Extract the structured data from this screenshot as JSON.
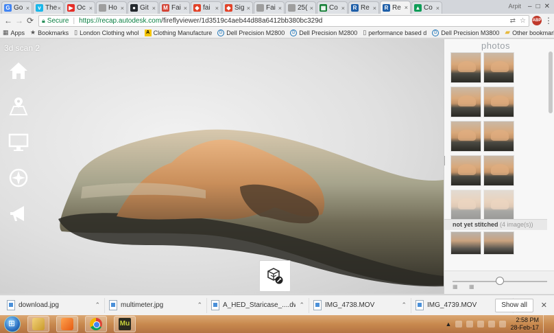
{
  "browser": {
    "tabs": [
      {
        "label": "Go",
        "favicon": "google-icon",
        "color": "#4285f4",
        "glyph": "G"
      },
      {
        "label": "The",
        "favicon": "vimeo-icon",
        "color": "#1ab7ea",
        "glyph": "v"
      },
      {
        "label": "Oc",
        "favicon": "youtube-icon",
        "color": "#e52d27",
        "glyph": "▶"
      },
      {
        "label": "Ho",
        "favicon": "page-icon",
        "color": "#9e9e9e",
        "glyph": ""
      },
      {
        "label": "Git",
        "favicon": "github-icon",
        "color": "#24292e",
        "glyph": "●"
      },
      {
        "label": "Fai",
        "favicon": "gmail-icon",
        "color": "#d44638",
        "glyph": "M"
      },
      {
        "label": "fai",
        "favicon": "gitlab-icon",
        "color": "#e24329",
        "glyph": "◆"
      },
      {
        "label": "Sig",
        "favicon": "gitlab-icon",
        "color": "#e24329",
        "glyph": "◆"
      },
      {
        "label": "Fai",
        "favicon": "page-icon",
        "color": "#9e9e9e",
        "glyph": ""
      },
      {
        "label": "25(",
        "favicon": "page-icon",
        "color": "#9e9e9e",
        "glyph": ""
      },
      {
        "label": "Co",
        "favicon": "sheets-icon",
        "color": "#188038",
        "glyph": "▦"
      },
      {
        "label": "Re",
        "favicon": "recap-icon",
        "color": "#1f5fa8",
        "glyph": "R"
      },
      {
        "label": "Re",
        "favicon": "recap-icon",
        "color": "#1f5fa8",
        "glyph": "R",
        "active": true
      },
      {
        "label": "Co",
        "favicon": "drive-icon",
        "color": "#0f9d58",
        "glyph": "▲"
      }
    ],
    "user_label": "Arpit",
    "address": {
      "secure_label": "Secure",
      "url_host": "https://recap.autodesk.com",
      "url_path": "/fireflyviewer/1d3519c4aeb44d88a6412bb380bc329d"
    },
    "abp_label": "ABP",
    "bookmarks": [
      {
        "label": "Apps",
        "icon": "apps-grid-icon",
        "glyph": "▦"
      },
      {
        "label": "Bookmarks",
        "icon": "star-icon",
        "glyph": "★"
      },
      {
        "label": "London Clothing whol",
        "icon": "page-icon",
        "glyph": "▯"
      },
      {
        "label": "Clothing Manufacture",
        "icon": "cm-icon",
        "glyph": "A"
      },
      {
        "label": "Dell Precision M2800",
        "icon": "dell-icon",
        "glyph": "D"
      },
      {
        "label": "Dell Precision M2800",
        "icon": "dell-icon",
        "glyph": "D"
      },
      {
        "label": "performance based d",
        "icon": "page-icon",
        "glyph": "▯"
      },
      {
        "label": "Dell Precision M3800",
        "icon": "dell-icon",
        "glyph": "D"
      }
    ],
    "other_bookmarks": "Other bookmarks"
  },
  "viewer": {
    "title": "3d scan 2",
    "tools": [
      "home-icon",
      "map-pin-icon",
      "monitor-icon",
      "compass-icon",
      "megaphone-icon"
    ]
  },
  "photos_panel": {
    "title": "photos",
    "thumb_count": 10,
    "not_yet_stitched_label": "not yet stitched",
    "not_yet_stitched_count": "(4 image(s))",
    "zoom_level": 0.5
  },
  "downloads": [
    {
      "name": "download.jpg"
    },
    {
      "name": "multimeter.jpg"
    },
    {
      "name": "A_HED_Staricase_....dwg"
    },
    {
      "name": "IMG_4738.MOV"
    },
    {
      "name": "IMG_4739.MOV"
    }
  ],
  "downloads_show_all": "Show all",
  "taskbar": {
    "apps": [
      "explorer-icon",
      "media-player-icon",
      "chrome-icon",
      "muse-icon"
    ],
    "muse_label": "Mu",
    "time": "2:58 PM",
    "date": "28-Feb-17"
  }
}
